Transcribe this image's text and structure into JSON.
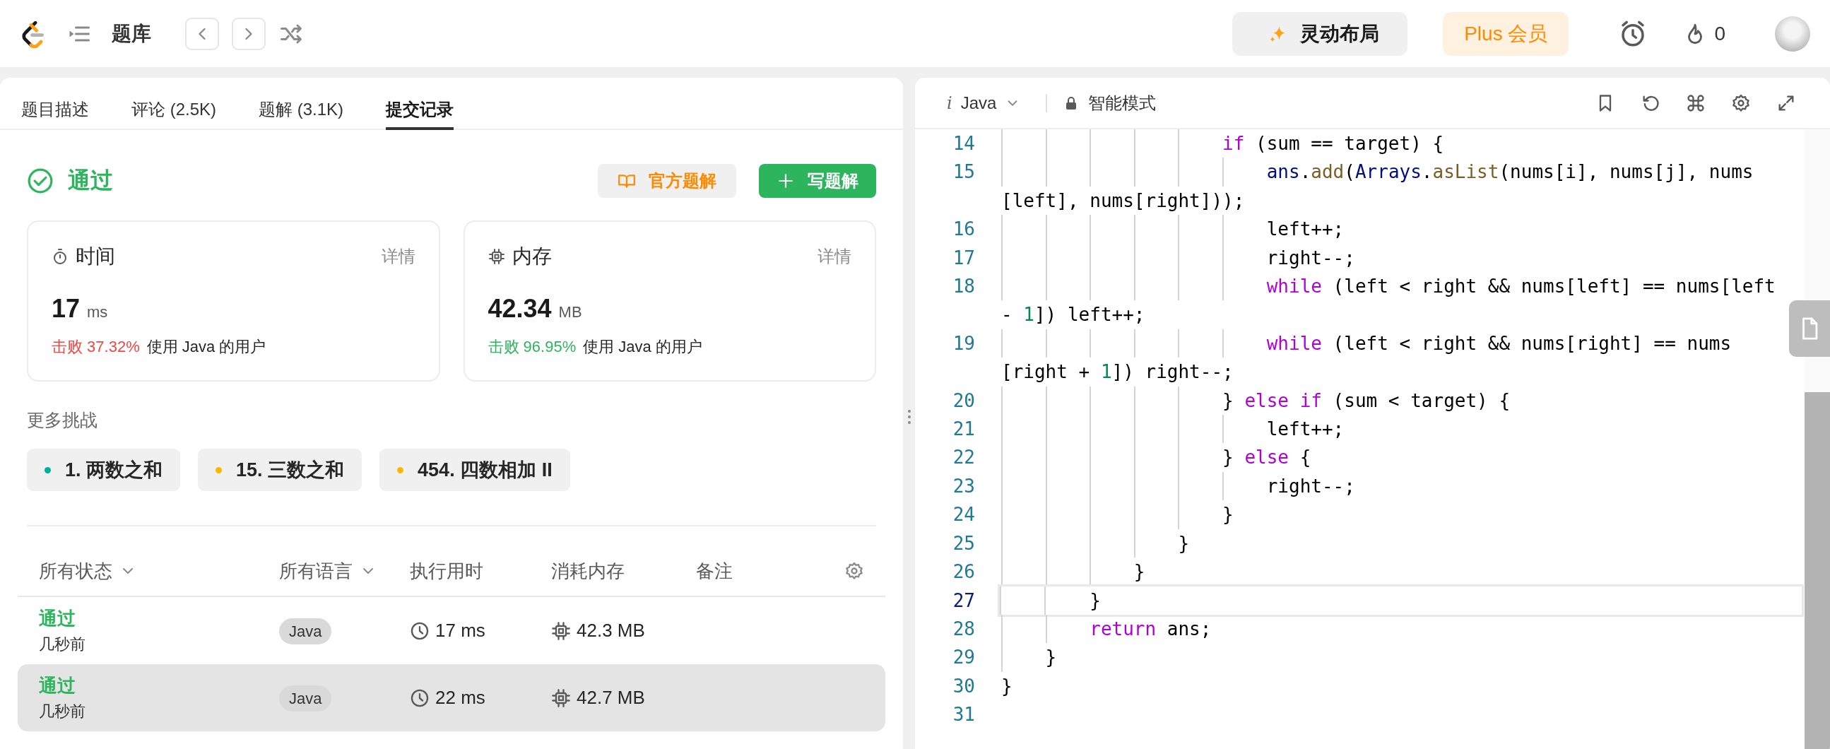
{
  "topbar": {
    "title": "题库",
    "buttons": [
      {
        "label": "灵动布局",
        "kind": "layout"
      },
      {
        "label": "Plus 会员",
        "kind": "plus"
      }
    ],
    "streak": "0"
  },
  "left_panel": {
    "tabs": [
      {
        "label": "题目描述",
        "selected": false
      },
      {
        "label": "评论 (2.5K)",
        "selected": false
      },
      {
        "label": "题解 (3.1K)",
        "selected": false
      },
      {
        "label": "提交记录",
        "selected": true
      }
    ],
    "result": {
      "status": "通过",
      "actions": [
        {
          "label": "官方题解",
          "kind": "secondary"
        },
        {
          "label": "写题解",
          "kind": "primary"
        }
      ]
    },
    "stats": [
      {
        "kind": "time",
        "title": "时间",
        "detail": "详情",
        "value": "17",
        "unit": "ms",
        "beats": "击败 37.32%",
        "color": "#ef4743",
        "suffix": "使用 Java 的用户"
      },
      {
        "kind": "memory",
        "title": "内存",
        "detail": "详情",
        "value": "42.34",
        "unit": "MB",
        "beats": "击败 96.95%",
        "color": "#2db55d",
        "suffix": "使用 Java 的用户"
      }
    ],
    "more_title": "更多挑战",
    "challenges": [
      {
        "label": "1. 两数之和",
        "color": "#00af9b"
      },
      {
        "label": "15. 三数之和",
        "color": "#ffb800"
      },
      {
        "label": "454. 四数相加 II",
        "color": "#ffb800"
      }
    ],
    "table": {
      "columns": [
        {
          "label": "所有状态",
          "dropdown": true
        },
        {
          "label": "所有语言",
          "dropdown": true
        },
        {
          "label": "执行用时",
          "dropdown": false
        },
        {
          "label": "消耗内存",
          "dropdown": false
        },
        {
          "label": "备注",
          "dropdown": false
        }
      ],
      "rows": [
        {
          "status": "通过",
          "time_ago": "几秒前",
          "language": "Java",
          "runtime": "17 ms",
          "memory": "42.3 MB",
          "selected": false
        },
        {
          "status": "通过",
          "time_ago": "几秒前",
          "language": "Java",
          "runtime": "22 ms",
          "memory": "42.7 MB",
          "selected": true
        }
      ]
    }
  },
  "editor": {
    "language_prefix": "i",
    "language": "Java",
    "mode": "智能模式",
    "lines": [
      {
        "number": "14",
        "current": false,
        "tokens": [
          {
            "kind": "kw",
            "text": "                    if"
          },
          {
            "kind": "plain",
            "text": " (sum == target) {"
          }
        ]
      },
      {
        "number": "15",
        "current": false,
        "tokens": [
          {
            "kind": "var",
            "text": "                        ans"
          },
          {
            "kind": "plain",
            "text": "."
          },
          {
            "kind": "fn",
            "text": "add"
          },
          {
            "kind": "plain",
            "text": "("
          },
          {
            "kind": "var",
            "text": "Arrays"
          },
          {
            "kind": "plain",
            "text": "."
          },
          {
            "kind": "fn",
            "text": "asList"
          },
          {
            "kind": "plain",
            "text": "(nums[i], nums[j], nums"
          }
        ],
        "wrap": [
          {
            "kind": "plain",
            "text": "[left], nums[right]));"
          }
        ]
      },
      {
        "number": "16",
        "current": false,
        "tokens": [
          {
            "kind": "plain",
            "text": "                        left++;"
          }
        ]
      },
      {
        "number": "17",
        "current": false,
        "tokens": [
          {
            "kind": "plain",
            "text": "                        right--;"
          }
        ]
      },
      {
        "number": "18",
        "current": false,
        "tokens": [
          {
            "kind": "kw",
            "text": "                        while"
          },
          {
            "kind": "plain",
            "text": " (left < right && nums[left] == nums[left"
          }
        ],
        "wrap": [
          {
            "kind": "plain",
            "text": "- "
          },
          {
            "kind": "num",
            "text": "1"
          },
          {
            "kind": "plain",
            "text": "]) left++;"
          }
        ]
      },
      {
        "number": "19",
        "current": false,
        "tokens": [
          {
            "kind": "kw",
            "text": "                        while"
          },
          {
            "kind": "plain",
            "text": " (left < right && nums[right] == nums"
          }
        ],
        "wrap": [
          {
            "kind": "plain",
            "text": "[right + "
          },
          {
            "kind": "num",
            "text": "1"
          },
          {
            "kind": "plain",
            "text": "]) right--;"
          }
        ]
      },
      {
        "number": "20",
        "current": false,
        "tokens": [
          {
            "kind": "plain",
            "text": "                    } "
          },
          {
            "kind": "kw",
            "text": "else if"
          },
          {
            "kind": "plain",
            "text": " (sum < target) {"
          }
        ]
      },
      {
        "number": "21",
        "current": false,
        "tokens": [
          {
            "kind": "plain",
            "text": "                        left++;"
          }
        ]
      },
      {
        "number": "22",
        "current": false,
        "tokens": [
          {
            "kind": "plain",
            "text": "                    } "
          },
          {
            "kind": "kw",
            "text": "else"
          },
          {
            "kind": "plain",
            "text": " {"
          }
        ]
      },
      {
        "number": "23",
        "current": false,
        "tokens": [
          {
            "kind": "plain",
            "text": "                        right--;"
          }
        ]
      },
      {
        "number": "24",
        "current": false,
        "tokens": [
          {
            "kind": "plain",
            "text": "                    }"
          }
        ]
      },
      {
        "number": "25",
        "current": false,
        "tokens": [
          {
            "kind": "plain",
            "text": "                }"
          }
        ]
      },
      {
        "number": "26",
        "current": false,
        "tokens": [
          {
            "kind": "plain",
            "text": "            }"
          }
        ]
      },
      {
        "number": "27",
        "current": true,
        "tokens": [
          {
            "kind": "plain",
            "text": "        }"
          }
        ]
      },
      {
        "number": "28",
        "current": false,
        "tokens": [
          {
            "kind": "kw",
            "text": "        return"
          },
          {
            "kind": "plain",
            "text": " ans;"
          }
        ]
      },
      {
        "number": "29",
        "current": false,
        "tokens": [
          {
            "kind": "plain",
            "text": "    }"
          }
        ]
      },
      {
        "number": "30",
        "current": false,
        "tokens": [
          {
            "kind": "plain",
            "text": "}"
          }
        ]
      },
      {
        "number": "31",
        "current": false
      }
    ]
  }
}
